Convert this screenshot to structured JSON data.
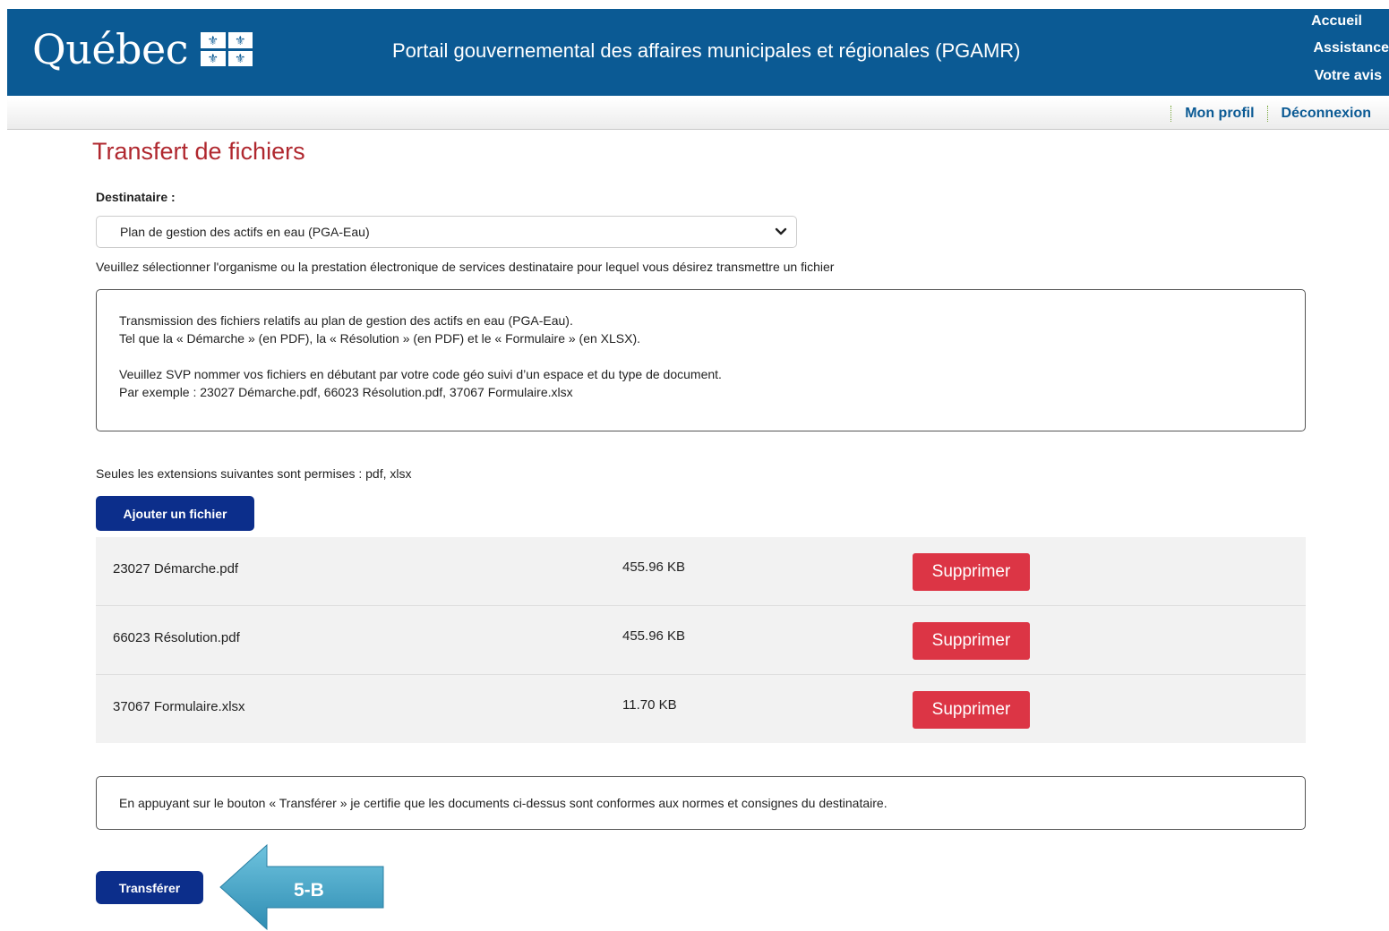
{
  "header": {
    "logo_text": "Québec",
    "portal_title": "Portail gouvernemental des affaires municipales et régionales (PGAMR)",
    "nav": [
      "Accueil",
      "Assistance",
      "Votre avis"
    ],
    "brand_color": "#0b5a94"
  },
  "user_nav": {
    "profile": "Mon profil",
    "logout": "Déconnexion"
  },
  "page": {
    "title": "Transfert de fichiers",
    "recipient_label": "Destinataire :",
    "recipient_selected": "Plan de gestion des actifs en eau (PGA-Eau)",
    "recipient_help": "Veuillez sélectionner l'organisme ou la prestation électronique de services destinataire pour lequel vous désirez transmettre un fichier",
    "info_lines": [
      "Transmission des fichiers relatifs au plan de gestion des actifs en eau (PGA-Eau).",
      "Tel que la « Démarche » (en PDF), la « Résolution » (en PDF) et le « Formulaire » (en XLSX).",
      "Veuillez SVP nommer vos fichiers en débutant par votre code géo suivi d’un espace et du type de document.",
      "Par exemple : 23027 Démarche.pdf, 66023 Résolution.pdf, 37067 Formulaire.xlsx"
    ],
    "extensions_note": "Seules les extensions suivantes sont permises : pdf, xlsx",
    "add_file_label": "Ajouter un fichier",
    "files": [
      {
        "name": "23027 Démarche.pdf",
        "size": "455.96 KB",
        "action": "Supprimer"
      },
      {
        "name": "66023 Résolution.pdf",
        "size": "455.96 KB",
        "action": "Supprimer"
      },
      {
        "name": "37067 Formulaire.xlsx",
        "size": "11.70 KB",
        "action": "Supprimer"
      }
    ],
    "certification": "En appuyant sur le bouton « Transférer » je certifie que les documents ci-dessus sont conformes aux normes et consignes du destinataire.",
    "transfer_label": "Transférer"
  },
  "callout": {
    "label": "5-B",
    "color": "#4aa6c9"
  },
  "colors": {
    "title": "#b0282f",
    "primary_button": "#0c2e8b",
    "delete_button": "#dc3545"
  }
}
